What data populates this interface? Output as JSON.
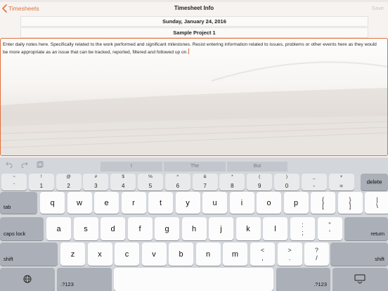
{
  "nav": {
    "back_label": "Timesheets",
    "title": "Timesheet Info",
    "save_label": "Save"
  },
  "form": {
    "date": "Sunday, January 24, 2016",
    "project": "Sample Project 1",
    "notes": "Enter daily notes here. Specifically related to the work performed and significant milestones. Resist entering information related to issues, problems or other events here as they would be more appropriate as an issue that can be tracked, reported, filtered and followed up on."
  },
  "keyboard": {
    "suggestions": [
      "I",
      "The",
      "But"
    ],
    "number_row": [
      {
        "top": "~",
        "bot": "`"
      },
      {
        "top": "!",
        "bot": "1"
      },
      {
        "top": "@",
        "bot": "2"
      },
      {
        "top": "#",
        "bot": "3"
      },
      {
        "top": "$",
        "bot": "4"
      },
      {
        "top": "%",
        "bot": "5"
      },
      {
        "top": "^",
        "bot": "6"
      },
      {
        "top": "&",
        "bot": "7"
      },
      {
        "top": "*",
        "bot": "8"
      },
      {
        "top": "(",
        "bot": "9"
      },
      {
        "top": ")",
        "bot": "0"
      },
      {
        "top": "_",
        "bot": "-"
      },
      {
        "top": "+",
        "bot": "="
      }
    ],
    "delete_label": "delete",
    "tab_label": "tab",
    "row1": [
      "q",
      "w",
      "e",
      "r",
      "t",
      "y",
      "u",
      "i",
      "o",
      "p"
    ],
    "row1_symbols": [
      {
        "top": "{",
        "bot": "["
      },
      {
        "top": "}",
        "bot": "]"
      },
      {
        "top": "|",
        "bot": "\\"
      }
    ],
    "caps_label": "caps lock",
    "row2": [
      "a",
      "s",
      "d",
      "f",
      "g",
      "h",
      "j",
      "k",
      "l"
    ],
    "row2_symbols": [
      {
        "top": ":",
        "bot": ";"
      },
      {
        "top": "\"",
        "bot": "'"
      }
    ],
    "return_label": "return",
    "shift_label": "shift",
    "row3": [
      "z",
      "x",
      "c",
      "v",
      "b",
      "n",
      "m"
    ],
    "row3_symbols": [
      {
        "top": "<",
        "bot": ","
      },
      {
        "top": ">",
        "bot": "."
      },
      {
        "top": "?",
        "bot": "/"
      }
    ],
    "numbers_label": ".?123"
  }
}
